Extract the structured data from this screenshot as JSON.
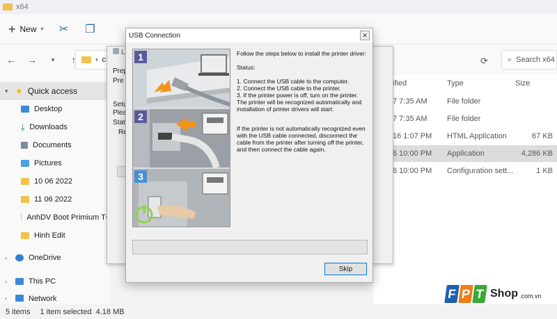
{
  "explorer": {
    "title": "x64",
    "toolbar": {
      "new_label": "New"
    },
    "address": {
      "crumb": "c"
    },
    "search": {
      "placeholder": "Search x64"
    },
    "sidebar": {
      "items": [
        {
          "label": "Quick access",
          "icon": "star-icon"
        },
        {
          "label": "Desktop",
          "icon": "desktop-icon"
        },
        {
          "label": "Downloads",
          "icon": "download-icon"
        },
        {
          "label": "Documents",
          "icon": "document-icon"
        },
        {
          "label": "Pictures",
          "icon": "picture-icon"
        },
        {
          "label": "10 06 2022",
          "icon": "folder-icon"
        },
        {
          "label": "11 06 2022",
          "icon": "folder-icon"
        },
        {
          "label": "AnhDV Boot Primium T6",
          "icon": "folder-icon"
        },
        {
          "label": "Hinh Edit",
          "icon": "folder-icon"
        },
        {
          "label": "OneDrive",
          "icon": "cloud-icon"
        },
        {
          "label": "This PC",
          "icon": "computer-icon"
        },
        {
          "label": "Network",
          "icon": "network-icon"
        }
      ]
    },
    "columns": {
      "modified": "ified",
      "type": "Type",
      "size": "Size"
    },
    "rows": [
      {
        "date": "7 7:35 AM",
        "type": "File folder",
        "size": ""
      },
      {
        "date": "7 7:35 AM",
        "type": "File folder",
        "size": ""
      },
      {
        "date": "16 1:07 PM",
        "type": "HTML Application",
        "size": "67 KB"
      },
      {
        "date": "6 10:00 PM",
        "type": "Application",
        "size": "4,286 KB"
      },
      {
        "date": "6 10:00 PM",
        "type": "Configuration sett...",
        "size": "1 KB"
      }
    ],
    "status": {
      "count": "5 items",
      "selection": "1 item selected  4.18 MB"
    }
  },
  "installer": {
    "title_fragment": "Li",
    "lines": [
      "Prep",
      "Pre",
      "Setu",
      "Plea",
      "Stat",
      "Re"
    ]
  },
  "dialog": {
    "title": "USB Connection",
    "step_numbers": [
      "1",
      "2",
      "3"
    ],
    "intro": "Follow the steps below to install the printer driver:",
    "status_label": "Status:",
    "steps": [
      "1. Connect the USB cable to the computer.",
      "2. Connect the USB cable to the printer.",
      "3. If the printer power is off, turn on the printer."
    ],
    "auto_note": "The printer will be recognized automatically and installation of printer drivers will start.",
    "fallback_note": "If the printer is not automatically recognized even with the USB cable connected, disconnect the cable from the printer after turning off the printer, and then connect the cable again.",
    "skip_label": "Skip"
  },
  "watermark": {
    "letters": [
      "F",
      "P",
      "T"
    ],
    "shop": "Shop",
    "domain": ".com.vn"
  },
  "colors": {
    "accent_blue": "#0078d7",
    "folder_yellow": "#f2c14e",
    "fpt_blue": "#1f5fae",
    "fpt_orange": "#f07d1a",
    "fpt_green": "#3aa935",
    "step_purple": "#5a5a9a",
    "step_blue": "#4a8fd6"
  }
}
